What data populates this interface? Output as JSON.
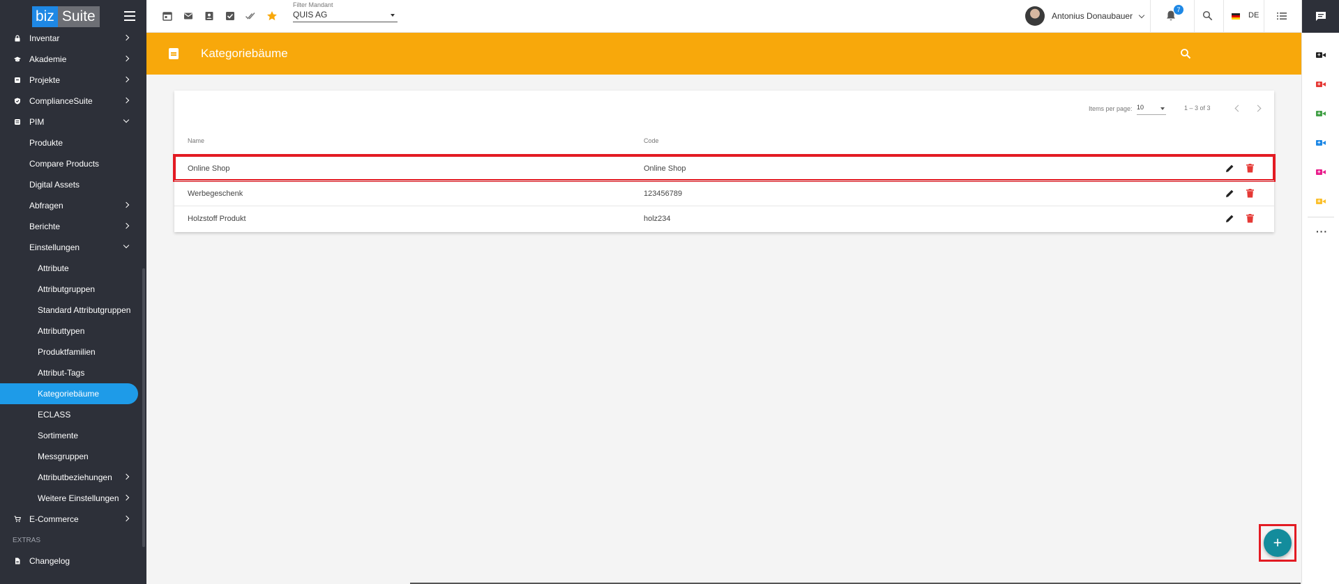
{
  "brand": {
    "biz": "biz",
    "suite": "Suite"
  },
  "sidebar": {
    "items": [
      {
        "label": "Inventar",
        "icon": "lock-icon",
        "expandable": true
      },
      {
        "label": "Akademie",
        "icon": "graduation-cap-icon",
        "expandable": true
      },
      {
        "label": "Projekte",
        "icon": "project-icon",
        "expandable": true
      },
      {
        "label": "ComplianceSuite",
        "icon": "shield-icon",
        "expandable": true
      },
      {
        "label": "PIM",
        "icon": "pim-icon",
        "expanded": true
      }
    ],
    "pim_children": [
      {
        "label": "Produkte"
      },
      {
        "label": "Compare Products"
      },
      {
        "label": "Digital Assets"
      },
      {
        "label": "Abfragen",
        "expandable": true
      },
      {
        "label": "Berichte",
        "expandable": true
      },
      {
        "label": "Einstellungen",
        "expanded": true
      }
    ],
    "settings_children": [
      {
        "label": "Attribute"
      },
      {
        "label": "Attributgruppen"
      },
      {
        "label": "Standard Attributgruppen"
      },
      {
        "label": "Attributtypen"
      },
      {
        "label": "Produktfamilien"
      },
      {
        "label": "Attribut-Tags"
      },
      {
        "label": "Kategoriebäume",
        "active": true
      },
      {
        "label": "ECLASS"
      },
      {
        "label": "Sortimente"
      },
      {
        "label": "Messgruppen"
      },
      {
        "label": "Attributbeziehungen",
        "expandable": true
      },
      {
        "label": "Weitere Einstellungen",
        "expandable": true
      }
    ],
    "ecommerce": {
      "label": "E-Commerce",
      "icon": "cart-icon"
    },
    "section_extras": "EXTRAS",
    "changelog": {
      "label": "Changelog",
      "icon": "document-icon"
    }
  },
  "topbar": {
    "icons": [
      "calendar-icon",
      "mail-icon",
      "contact-icon",
      "checkbox-icon",
      "done-all-icon",
      "star-icon"
    ],
    "mandant": {
      "label": "Filter Mandant",
      "value": "QUIS AG"
    },
    "user": {
      "name": "Antonius Donaubauer"
    },
    "notifications": {
      "count": "7"
    },
    "language": "DE"
  },
  "header": {
    "title": "Kategoriebäume"
  },
  "table": {
    "items_per_page_label": "Items per page:",
    "items_per_page": "10",
    "range": "1 – 3 of 3",
    "columns": {
      "name": "Name",
      "code": "Code"
    },
    "rows": [
      {
        "name": "Online Shop",
        "code": "Online Shop"
      },
      {
        "name": "Werbegeschenk",
        "code": "123456789"
      },
      {
        "name": "Holzstoff Produkt",
        "code": "holz234"
      }
    ]
  },
  "fab": {
    "label": "+"
  },
  "colors": {
    "sidebar_bg": "#2d3039",
    "accent_blue": "#1e9be8",
    "header_orange": "#f8a80b",
    "fab_teal": "#138c9c",
    "highlight_red": "#e31b23",
    "delete_red": "#e53935",
    "rail_icons": [
      "#222222",
      "#e53935",
      "#43a047",
      "#1e88e5",
      "#e91e8c",
      "#fbc02d"
    ]
  }
}
